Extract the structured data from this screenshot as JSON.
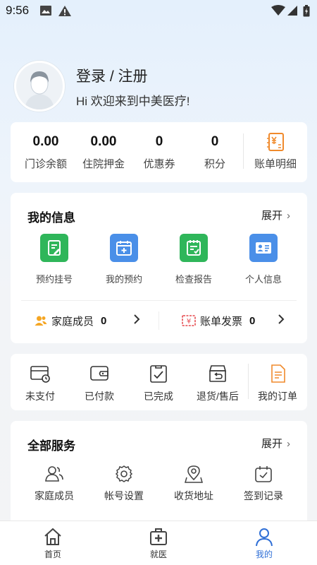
{
  "status_bar": {
    "time": "9:56"
  },
  "profile": {
    "title": "登录 / 注册",
    "welcome": "Hi 欢迎来到中美医疗!"
  },
  "balance": {
    "items": [
      {
        "value": "0.00",
        "label": "门诊余额"
      },
      {
        "value": "0.00",
        "label": "住院押金"
      },
      {
        "value": "0",
        "label": "优惠券"
      },
      {
        "value": "0",
        "label": "积分"
      }
    ],
    "bill_detail_label": "账单明细",
    "bill_icon": "bill-icon"
  },
  "info": {
    "title": "我的信息",
    "expand_label": "展开",
    "items": [
      {
        "label": "预约挂号",
        "icon": "edit-document-icon",
        "color": "#2fb65a"
      },
      {
        "label": "我的预约",
        "icon": "calendar-add-icon",
        "color": "#4a8fe8"
      },
      {
        "label": "检查报告",
        "icon": "report-check-icon",
        "color": "#2fb65a"
      },
      {
        "label": "个人信息",
        "icon": "id-card-icon",
        "color": "#4a8fe8"
      }
    ],
    "family": {
      "label": "家庭成员",
      "count": "0"
    },
    "invoice": {
      "label": "账单发票",
      "count": "0"
    }
  },
  "orders": {
    "items": [
      {
        "label": "未支付",
        "icon": "wallet-clock-icon"
      },
      {
        "label": "已付款",
        "icon": "wallet-icon"
      },
      {
        "label": "已完成",
        "icon": "clipboard-check-icon"
      },
      {
        "label": "退货/售后",
        "icon": "return-box-icon"
      }
    ],
    "my_orders_label": "我的订单"
  },
  "services": {
    "title": "全部服务",
    "expand_label": "展开",
    "items": [
      {
        "label": "家庭成员",
        "icon": "users-icon"
      },
      {
        "label": "帐号设置",
        "icon": "gear-icon"
      },
      {
        "label": "收货地址",
        "icon": "map-pin-icon"
      },
      {
        "label": "签到记录",
        "icon": "calendar-check-icon"
      }
    ]
  },
  "bottom_nav": {
    "items": [
      {
        "label": "首页",
        "icon": "home-icon"
      },
      {
        "label": "就医",
        "icon": "medical-kit-icon"
      },
      {
        "label": "我的",
        "icon": "person-icon",
        "active": true
      }
    ]
  },
  "colors": {
    "accent": "#2f6fd6",
    "orange": "#f08a2c",
    "green": "#2fb65a",
    "blue": "#4a8fe8"
  }
}
